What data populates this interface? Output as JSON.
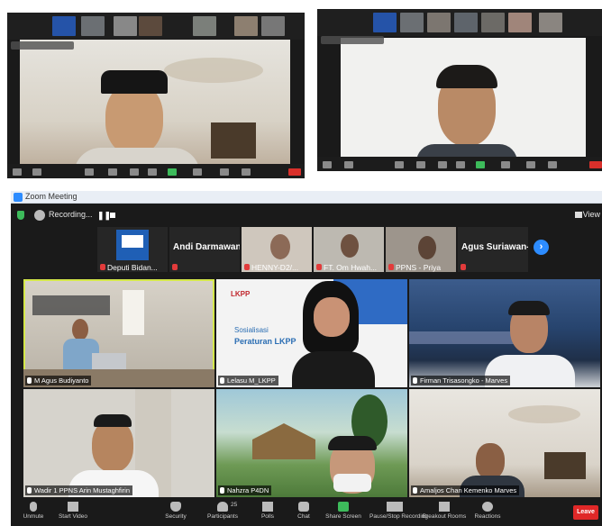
{
  "window": {
    "title": "Zoom Meeting"
  },
  "recording": {
    "label": "Recording..."
  },
  "view": {
    "label": "View"
  },
  "strip": {
    "tile1_name": "Deputi Bidan...",
    "tile2_big": "Andi Darmawan...",
    "tile3_name": "HENNY-D2/...",
    "tile4_name": "FT. Om Hwah...",
    "tile5_name": "PPNS - Priya",
    "tile6_big": "Agus Suriawan-..."
  },
  "grid": [
    {
      "name": "M Agus Budiyanto"
    },
    {
      "name": "Lelasu M_LKPP"
    },
    {
      "name": "Firman Trisasongko - Marves"
    },
    {
      "name": "Wadir 1 PPNS Arin Mustaghfirin"
    },
    {
      "name": "Nahzra P4DN"
    },
    {
      "name": "Amaljos Chan Kemenko Marves"
    }
  ],
  "slide": {
    "logo": "LKPP",
    "line1": "Sosialisasi",
    "line2": "Peraturan LKPP"
  },
  "toolbar": {
    "unmute": "Unmute",
    "start_video": "Start Video",
    "security": "Security",
    "participants": "Participants",
    "participants_count": "25",
    "polls": "Polls",
    "chat": "Chat",
    "share": "Share Screen",
    "pause_rec": "Pause/Stop Recording",
    "breakout": "Breakout Rooms",
    "reactions": "Reactions",
    "leave": "Leave"
  },
  "colors": {
    "accent": "#2d8cff",
    "leave": "#e02828",
    "active_speaker": "#d5e84a",
    "share_green": "#3dbb5b"
  }
}
